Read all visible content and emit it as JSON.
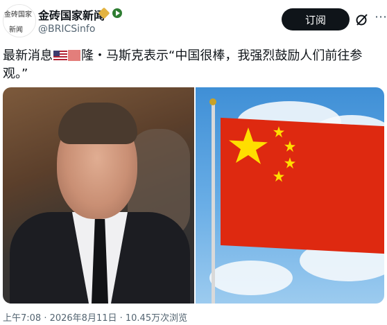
{
  "account": {
    "avatar_line1": "金砖国家",
    "avatar_line2": "新闻",
    "display_name": "金砖国家新闻",
    "handle": "@BRICSinfo"
  },
  "actions": {
    "subscribe_label": "订阅",
    "grok_icon": "grok-icon",
    "more_icon": "more-icon"
  },
  "tweet": {
    "prefix": "最新消息",
    "flag_icon": "us-flag-emoji",
    "text_after_flag": "隆・马斯克表示“中国很棒，我强烈鼓励人们前往参观。”"
  },
  "media": {
    "left_image": "portrait-photo",
    "right_image": "chinese-flag-photo"
  },
  "meta": {
    "footer": "上午7:08 · 2026年8月11日 · 10.45万次浏览"
  },
  "colors": {
    "button_bg": "#0f1419",
    "handle_text": "#536471",
    "flag_red": "#de2910",
    "flag_star": "#ffde00"
  }
}
